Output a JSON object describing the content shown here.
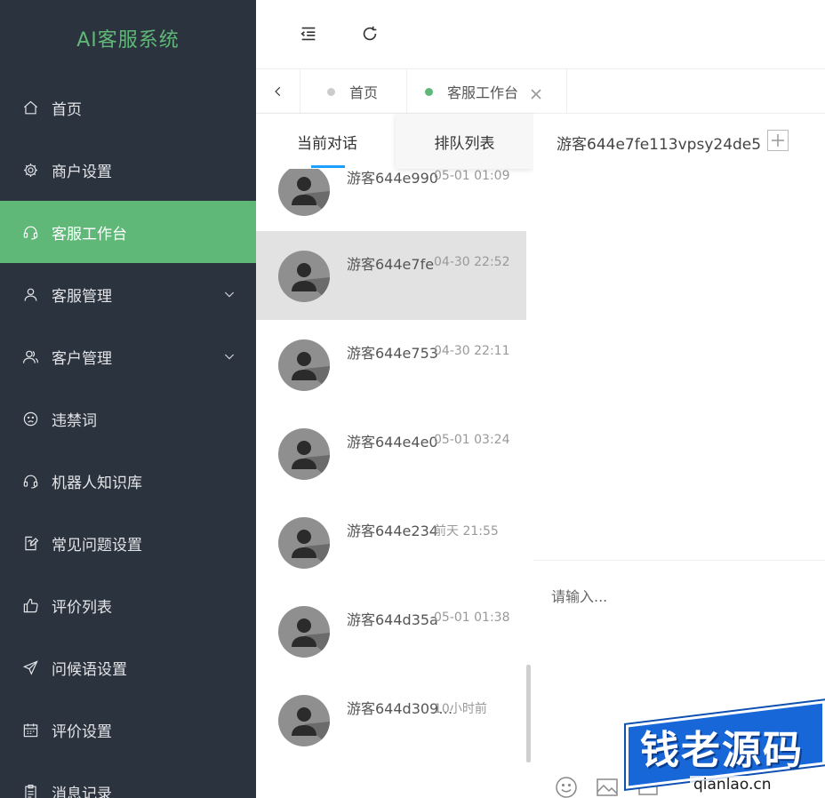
{
  "sidebar": {
    "brand": "AI客服系统",
    "items": [
      {
        "label": "首页",
        "icon": "home-icon"
      },
      {
        "label": "商户设置",
        "icon": "gear-icon"
      },
      {
        "label": "客服工作台",
        "icon": "headset-icon",
        "active": true
      },
      {
        "label": "客服管理",
        "icon": "user-icon",
        "expandable": true
      },
      {
        "label": "客户管理",
        "icon": "users-icon",
        "expandable": true
      },
      {
        "label": "违禁词",
        "icon": "frown-icon"
      },
      {
        "label": "机器人知识库",
        "icon": "headset-icon"
      },
      {
        "label": "常见问题设置",
        "icon": "edit-doc-icon"
      },
      {
        "label": "评价列表",
        "icon": "thumbs-up-icon"
      },
      {
        "label": "问候语设置",
        "icon": "send-icon"
      },
      {
        "label": "评价设置",
        "icon": "calendar-icon"
      },
      {
        "label": "消息记录",
        "icon": "clipboard-icon"
      }
    ],
    "colors": {
      "bg": "#2b333e",
      "active": "#5fb878",
      "brand": "#5fb878"
    }
  },
  "tabs": [
    {
      "label": "首页",
      "dot_color": "#cccccc"
    },
    {
      "label": "客服工作台",
      "dot_color": "#5fb878",
      "closable": true
    }
  ],
  "conversation_panel": {
    "subtabs": [
      "当前对话",
      "排队列表"
    ],
    "conversations": [
      {
        "name": "游客644e990",
        "time": "05-01 01:09"
      },
      {
        "name": "游客644e7fe",
        "time": "04-30 22:52",
        "selected": true
      },
      {
        "name": "游客644e753",
        "time": "04-30 22:11"
      },
      {
        "name": "游客644e4e0",
        "time": "05-01 03:24"
      },
      {
        "name": "游客644e234",
        "time": "前天 21:55"
      },
      {
        "name": "游客644d35a",
        "time": "05-01 01:38"
      },
      {
        "name": "游客644d309…",
        "time": "10小时前"
      }
    ]
  },
  "chat": {
    "title": "游客644e7fe113vpsy24de5",
    "input_placeholder": "请输入..."
  },
  "watermark": {
    "text": "钱老源码",
    "sub": "qianlao.cn"
  }
}
